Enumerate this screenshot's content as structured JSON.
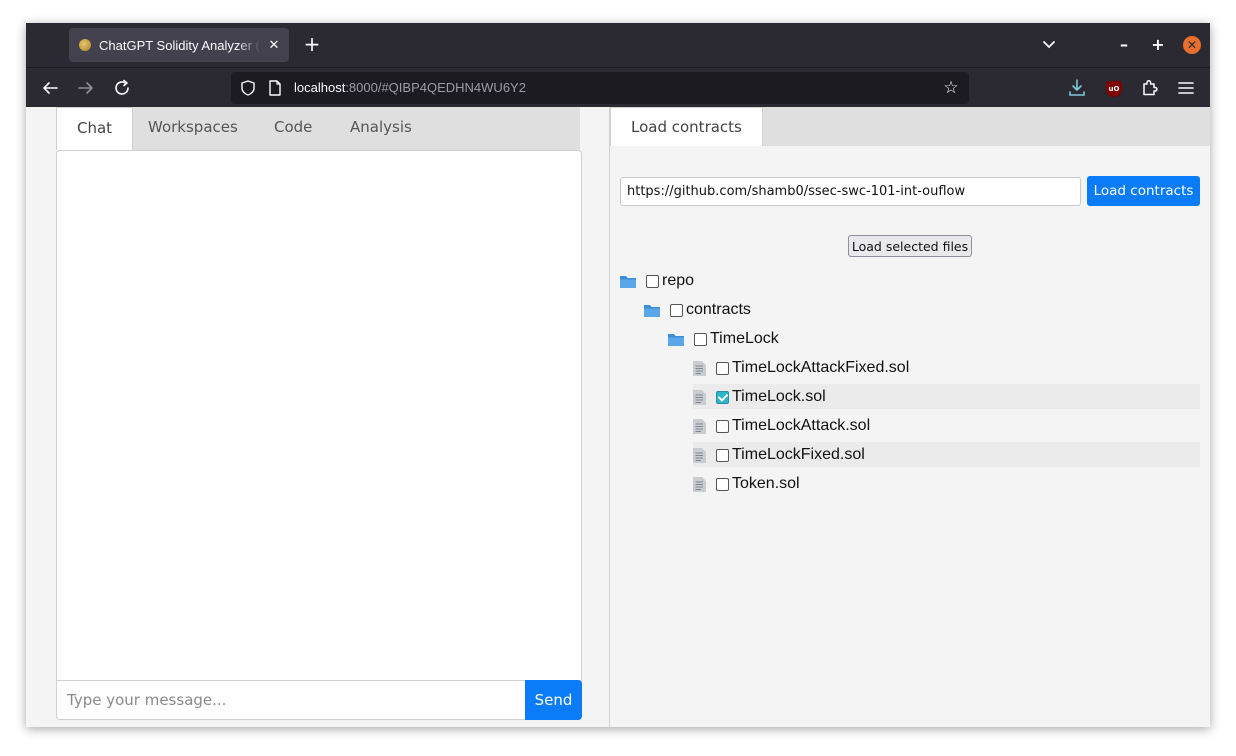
{
  "browser": {
    "tab_title": "ChatGPT Solidity Analyzer (S",
    "tab_close": "✕",
    "new_tab": "+",
    "url_host": "localhost",
    "url_rest": ":8000/#QIBP4QEDHN4WU6Y2",
    "window_min": "–",
    "window_max": "+",
    "window_close": "✕"
  },
  "left_pane": {
    "tabs": [
      {
        "label": "Chat",
        "active": true
      },
      {
        "label": "Workspaces",
        "active": false
      },
      {
        "label": "Code",
        "active": false
      },
      {
        "label": "Analysis",
        "active": false
      }
    ],
    "chat_input": {
      "value": "",
      "placeholder": "Type your message..."
    },
    "send_label": "Send"
  },
  "right_pane": {
    "tabs": [
      {
        "label": "Load contracts",
        "active": true
      }
    ],
    "repo_url": "https://github.com/shamb0/ssec-swc-101-int-ouflow",
    "load_button_label": "Load contracts",
    "load_selected_label": "Load selected files",
    "tree": [
      {
        "type": "folder",
        "label": "repo",
        "depth": 0,
        "checked": false
      },
      {
        "type": "folder",
        "label": "contracts",
        "depth": 1,
        "checked": false
      },
      {
        "type": "folder",
        "label": "TimeLock",
        "depth": 2,
        "checked": false
      },
      {
        "type": "file",
        "label": "TimeLockAttackFixed.sol",
        "depth": 3,
        "checked": false
      },
      {
        "type": "file",
        "label": "TimeLock.sol",
        "depth": 3,
        "checked": true
      },
      {
        "type": "file",
        "label": "TimeLockAttack.sol",
        "depth": 3,
        "checked": false
      },
      {
        "type": "file",
        "label": "TimeLockFixed.sol",
        "depth": 3,
        "checked": false
      },
      {
        "type": "file",
        "label": "Token.sol",
        "depth": 3,
        "checked": false
      }
    ]
  },
  "colors": {
    "accent": "#0a7cf7",
    "browser_chrome": "#2b2a33",
    "checked": "#2bb5c9",
    "folder": "#3c8ed8"
  }
}
